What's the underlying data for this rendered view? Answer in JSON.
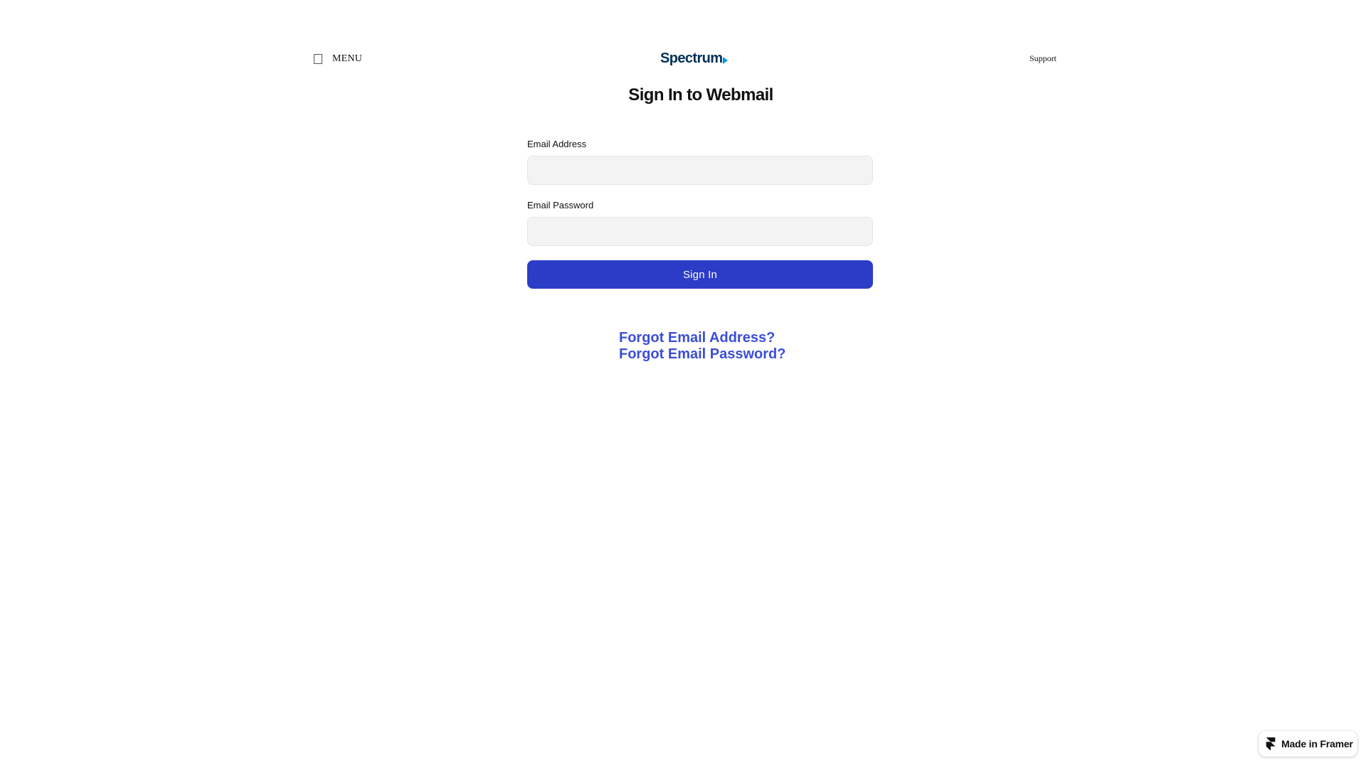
{
  "header": {
    "menu_label": "MENU",
    "logo_text": "Spectrum",
    "support_label": "Support"
  },
  "page": {
    "title": "Sign In to Webmail"
  },
  "form": {
    "email_label": "Email Address",
    "email_value": "",
    "password_label": "Email Password",
    "password_value": "",
    "submit_label": "Sign In"
  },
  "links": {
    "forgot_email": "Forgot Email Address?",
    "forgot_password": "Forgot Email Password?"
  },
  "badge": {
    "label": "Made in Framer"
  },
  "colors": {
    "brand_navy": "#003057",
    "brand_blue": "#0099d8",
    "button": "#2b3dc6",
    "link": "#3b4ed8",
    "input_bg": "#f3f3f3"
  }
}
